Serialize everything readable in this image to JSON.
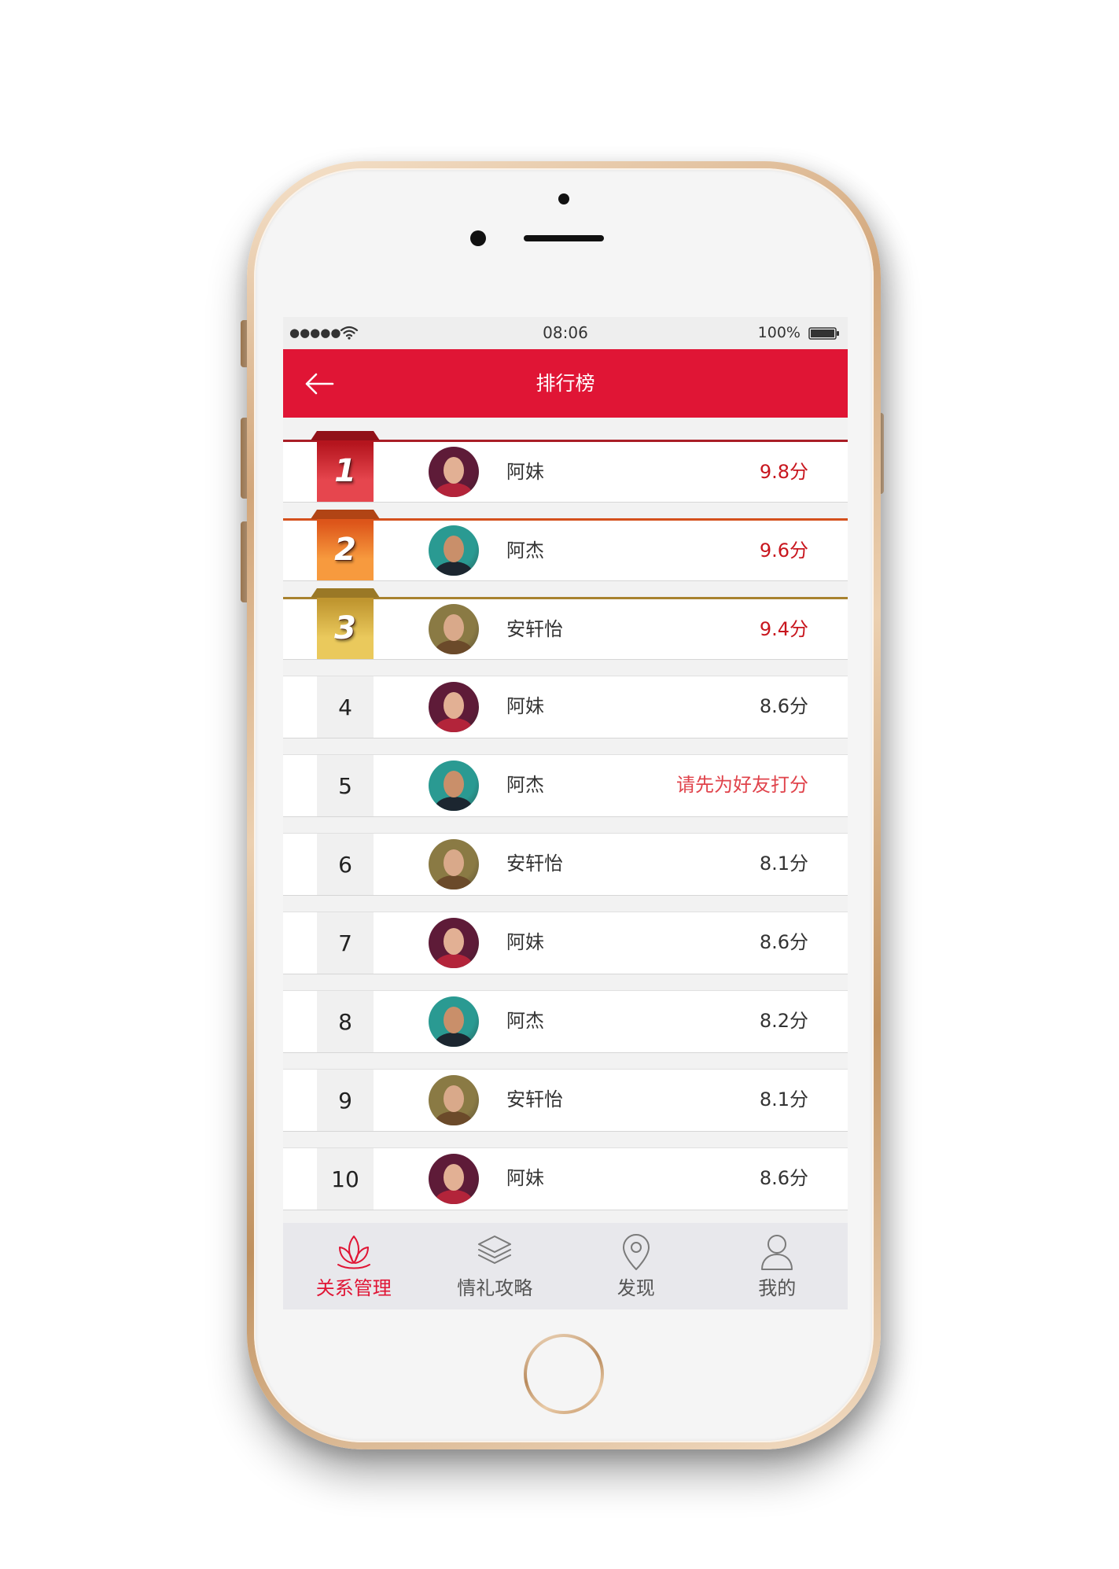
{
  "status_bar": {
    "signal": "●●●●●",
    "wifi_icon": "wifi-icon",
    "time": "08:06",
    "battery": "100%",
    "battery_icon": "battery-icon"
  },
  "header": {
    "back_icon": "arrow-left-icon",
    "title": "排行榜",
    "color": "#e01535"
  },
  "ranking": [
    {
      "rank": "1",
      "name": "阿妹",
      "score": "9.8分",
      "score_color": "#c8161e",
      "ribbon": {
        "dark": "#b5151e",
        "light": "#e6464e",
        "line": "#a91e26"
      },
      "avatar": {
        "bg": "#5e1b38",
        "face": "#e2b094",
        "cloth": "#b3243a"
      }
    },
    {
      "rank": "2",
      "name": "阿杰",
      "score": "9.6分",
      "score_color": "#c8161e",
      "ribbon": {
        "dark": "#dd551a",
        "light": "#f79a3e",
        "line": "#d4501c"
      },
      "avatar": {
        "bg": "#2a9a92",
        "face": "#c98f6a",
        "cloth": "#1c2630"
      }
    },
    {
      "rank": "3",
      "name": "安轩怡",
      "score": "9.4分",
      "score_color": "#c8161e",
      "ribbon": {
        "dark": "#c09630",
        "light": "#eac95c",
        "line": "#a8822f"
      },
      "avatar": {
        "bg": "#8a7a44",
        "face": "#d9a98a",
        "cloth": "#6b4a2a"
      }
    },
    {
      "rank": "4",
      "name": "阿妹",
      "score": "8.6分",
      "score_color": "#333333",
      "avatar": {
        "bg": "#5e1b38",
        "face": "#e2b094",
        "cloth": "#b3243a"
      }
    },
    {
      "rank": "5",
      "name": "阿杰",
      "score": "请先为好友打分",
      "score_color": "#e0434b",
      "avatar": {
        "bg": "#2a9a92",
        "face": "#c98f6a",
        "cloth": "#1c2630"
      }
    },
    {
      "rank": "6",
      "name": "安轩怡",
      "score": "8.1分",
      "score_color": "#333333",
      "avatar": {
        "bg": "#8a7a44",
        "face": "#d9a98a",
        "cloth": "#6b4a2a"
      }
    },
    {
      "rank": "7",
      "name": "阿妹",
      "score": "8.6分",
      "score_color": "#333333",
      "avatar": {
        "bg": "#5e1b38",
        "face": "#e2b094",
        "cloth": "#b3243a"
      }
    },
    {
      "rank": "8",
      "name": "阿杰",
      "score": "8.2分",
      "score_color": "#333333",
      "avatar": {
        "bg": "#2a9a92",
        "face": "#c98f6a",
        "cloth": "#1c2630"
      }
    },
    {
      "rank": "9",
      "name": "安轩怡",
      "score": "8.1分",
      "score_color": "#333333",
      "avatar": {
        "bg": "#8a7a44",
        "face": "#d9a98a",
        "cloth": "#6b4a2a"
      }
    },
    {
      "rank": "10",
      "name": "阿妹",
      "score": "8.6分",
      "score_color": "#333333",
      "avatar": {
        "bg": "#5e1b38",
        "face": "#e2b094",
        "cloth": "#b3243a"
      }
    }
  ],
  "tab_bar": {
    "active_color": "#e01535",
    "items": [
      {
        "label": "关系管理",
        "icon": "lotus-icon",
        "active": true
      },
      {
        "label": "情礼攻略",
        "icon": "layers-icon",
        "active": false
      },
      {
        "label": "发现",
        "icon": "location-pin-icon",
        "active": false
      },
      {
        "label": "我的",
        "icon": "person-icon",
        "active": false
      }
    ]
  }
}
